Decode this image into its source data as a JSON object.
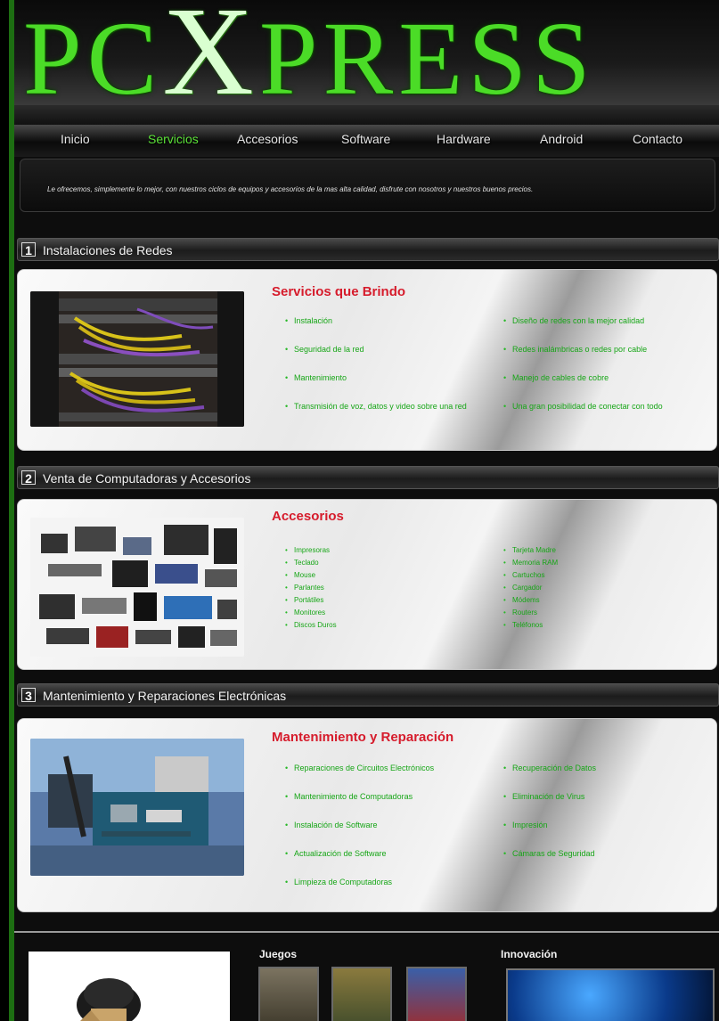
{
  "header": {
    "logo_left": "PC",
    "logo_x": "X",
    "logo_right": "PRESS"
  },
  "nav": {
    "items": [
      "Inicio",
      "Servicios",
      "Accesorios",
      "Software",
      "Hardware",
      "Android",
      "Contacto"
    ],
    "active": "Servicios"
  },
  "intro": {
    "text": "Le ofrecemos, simplemente lo mejor, con nuestros ciclos de equipos y accesorios de la mas alta calidad, disfrute con nosotros y nuestros buenos precios."
  },
  "sections": [
    {
      "number": "1",
      "title": "Instalaciones de Redes",
      "heading": "Servicios que Brindo",
      "left_items": [
        "Instalación",
        "Seguridad de la red",
        "Mantenimiento",
        "Transmisión de voz, datos y video sobre una red"
      ],
      "right_items": [
        "Diseño de redes con la mejor calidad",
        "Redes inalámbricas o redes por cable",
        "Manejo de cables de cobre",
        "Una gran posibilidad de conectar con todo"
      ]
    },
    {
      "number": "2",
      "title": "Venta de Computadoras y Accesorios",
      "heading": "Accesorios",
      "left_items": [
        "Impresoras",
        "Teclado",
        "Mouse",
        "Parlantes",
        "Portátiles",
        "Monitores",
        "Discos Duros"
      ],
      "right_items": [
        "Tarjeta Madre",
        "Memoria RAM",
        "Cartuchos",
        "Cargador",
        "Módems",
        "Routers",
        "Teléfonos"
      ]
    },
    {
      "number": "3",
      "title": "Mantenimiento y Reparaciones Electrónicas",
      "heading": "Mantenimiento y Reparación",
      "left_items": [
        "Reparaciones de Circuitos Electrónicos",
        "Mantenimiento de Computadoras",
        "Instalación de Software",
        "Actualización de Software",
        "Limpieza de Computadoras"
      ],
      "right_items": [
        "Recuperación de Datos",
        "Eliminación de Virus",
        "Impresión",
        "Cámaras de Seguridad"
      ]
    }
  ],
  "footer": {
    "games_title": "Juegos",
    "innovation_title": "Innovación"
  }
}
